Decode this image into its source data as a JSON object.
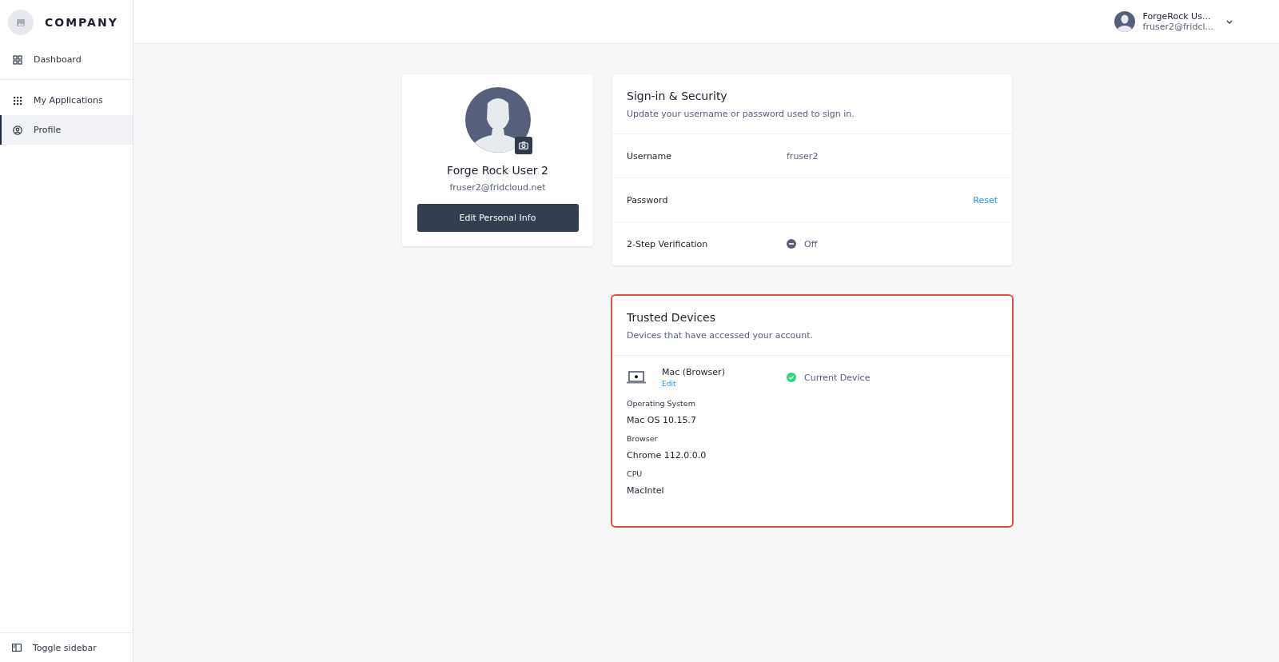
{
  "sidebar": {
    "logo_text": "COMPANY",
    "items": [
      {
        "label": "Dashboard",
        "kind": "dashboard",
        "selected": false
      },
      {
        "label": "My Applications",
        "kind": "apps",
        "selected": false
      },
      {
        "label": "Profile",
        "kind": "profile",
        "selected": true
      }
    ],
    "toggle": "Toggle sidebar"
  },
  "header": {
    "user_name": "ForgeRock Us...",
    "user_email": "fruser2@fridcl..."
  },
  "profile_card": {
    "name": "Forge Rock User 2",
    "email": "fruser2@fridcloud.net",
    "button": "Edit Personal Info"
  },
  "security": {
    "title": "Sign-in & Security",
    "subtitle": "Update your username or password used to sign in.",
    "rows": [
      {
        "label": "Username",
        "value": "fruser2",
        "kind": "text"
      },
      {
        "label": "Password",
        "action": "Reset",
        "kind": "action"
      },
      {
        "label": "2-Step Verification",
        "value": "Off",
        "on": false,
        "kind": "status"
      }
    ]
  },
  "trusted_devices": {
    "title": "Trusted Devices",
    "subtitle": "Devices that have accessed your account.",
    "highlighted": true,
    "devices": [
      {
        "name": "Mac (Browser)",
        "edit": "Edit",
        "status": "Current Device",
        "current": true,
        "details": [
          {
            "label": "Operating System",
            "value": "Mac OS 10.15.7"
          },
          {
            "label": "Browser",
            "value": "Chrome 112.0.0.0"
          },
          {
            "label": "CPU",
            "value": "MacIntel"
          }
        ]
      }
    ]
  }
}
